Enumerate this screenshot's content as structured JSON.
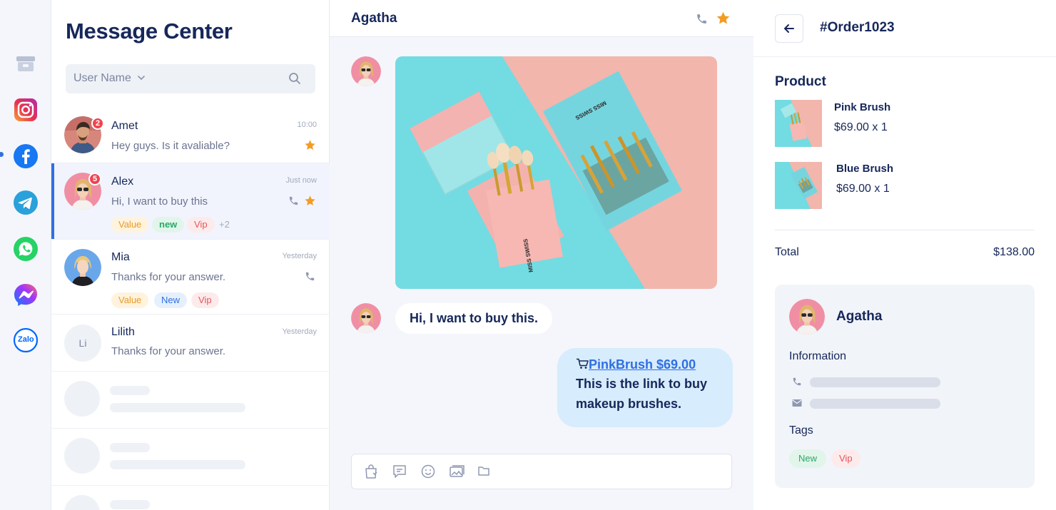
{
  "colors": {
    "accent": "#2f6fe4",
    "navy": "#16275a",
    "star": "#f39c23",
    "badge": "#f0444f"
  },
  "channels": [
    "store-icon",
    "instagram-icon",
    "facebook-icon",
    "telegram-icon",
    "whatsapp-icon",
    "messenger-icon",
    "zalo-icon"
  ],
  "zalo_label": "Zalo",
  "list": {
    "title": "Message Center",
    "search_placeholder": "User Name",
    "conversations": [
      {
        "name": "Amet",
        "message": "Hey guys. Is it avaliable?",
        "time": "10:00",
        "unread": "2"
      },
      {
        "name": "Alex",
        "message": "Hi, I want to buy this",
        "time": "Just now",
        "unread": "5",
        "tags": [
          "Value",
          "new",
          "Vip"
        ],
        "more": "+2"
      },
      {
        "name": "Mia",
        "message": "Thanks for your answer.",
        "time": "Yesterday",
        "tags": [
          "Value",
          "New",
          "Vip"
        ]
      },
      {
        "name": "Lilith",
        "message": "Thanks for your answer.",
        "time": "Yesterday",
        "initials": "Li"
      }
    ]
  },
  "chat": {
    "contact": "Agatha",
    "incoming_text": "Hi, I want to buy this.",
    "outgoing_link": "PinkBrush $69.00",
    "outgoing_text": "This is the link to buy makeup brushes.",
    "photo_brand": "MISS SWISS"
  },
  "order": {
    "title": "#Order1023",
    "section": "Product",
    "products": [
      {
        "name": "Pink Brush",
        "price": "$69.00 x 1"
      },
      {
        "name": "Blue Brush",
        "price": "$69.00 x 1"
      }
    ],
    "total_label": "Total",
    "total_value": "$138.00",
    "customer": {
      "name": "Agatha",
      "info_label": "Information",
      "tags_label": "Tags",
      "tags": [
        "New",
        "Vip"
      ]
    }
  }
}
